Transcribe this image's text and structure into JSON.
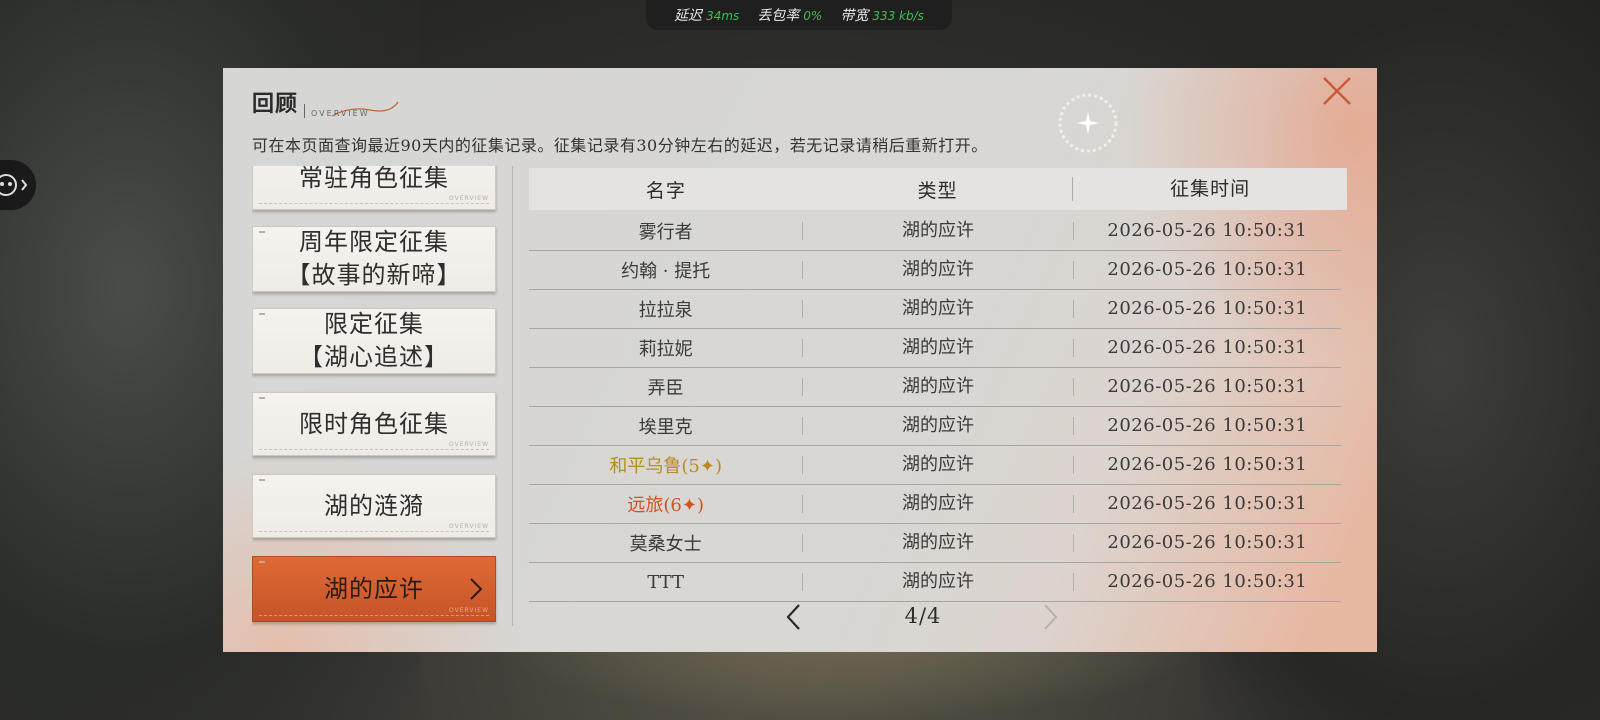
{
  "network": {
    "latency_label": "延迟",
    "latency_value": "34ms",
    "loss_label": "丢包率",
    "loss_value": "0%",
    "bandwidth_label": "带宽",
    "bandwidth_value": "333 kb/s"
  },
  "header": {
    "title": "回顾",
    "subtitle": "OVERVIEW",
    "notice": "可在本页面查询最近90天内的征集记录。征集记录有30分钟左右的延迟，若无记录请稍后重新打开。"
  },
  "categories": [
    {
      "label": "常驻角色征集",
      "foot": "OVERVIEW"
    },
    {
      "label": "周年限定征集\n【故事的新啼】",
      "foot": "OVERVIEW"
    },
    {
      "label": "限定征集\n【湖心追述】",
      "foot": "OVERVIEW"
    },
    {
      "label": "限时角色征集",
      "foot": "OVERVIEW"
    },
    {
      "label": "湖的涟漪",
      "foot": "OVERVIEW"
    },
    {
      "label": "湖的应许",
      "foot": "OVERVIEW",
      "active": true
    }
  ],
  "table": {
    "columns": [
      "名字",
      "类型",
      "征集时间"
    ],
    "rows": [
      {
        "name": "雾行者",
        "type": "湖的应许",
        "time": "2026-05-26 10:50:31"
      },
      {
        "name": "约翰 · 提托",
        "type": "湖的应许",
        "time": "2026-05-26 10:50:31"
      },
      {
        "name": "拉拉泉",
        "type": "湖的应许",
        "time": "2026-05-26 10:50:31"
      },
      {
        "name": "莉拉妮",
        "type": "湖的应许",
        "time": "2026-05-26 10:50:31"
      },
      {
        "name": "弄臣",
        "type": "湖的应许",
        "time": "2026-05-26 10:50:31"
      },
      {
        "name": "埃里克",
        "type": "湖的应许",
        "time": "2026-05-26 10:50:31"
      },
      {
        "name": "和平乌鲁(5",
        "star": "✦",
        "close": ")",
        "type": "湖的应许",
        "time": "2026-05-26 10:50:31",
        "rarity": "gold"
      },
      {
        "name": "远旅(6",
        "star": "✦",
        "close": ")",
        "type": "湖的应许",
        "time": "2026-05-26 10:50:31",
        "rarity": "orange"
      },
      {
        "name": "莫桑女士",
        "type": "湖的应许",
        "time": "2026-05-26 10:50:31"
      },
      {
        "name": "TTT",
        "type": "湖的应许",
        "time": "2026-05-26 10:50:31"
      }
    ]
  },
  "pagination": {
    "current": "4/4"
  },
  "colors": {
    "accent": "#d75e2e",
    "gold": "#b98a25",
    "orange": "#d0541c",
    "latency_green": "#3fbf55"
  },
  "icons": {
    "close": "close-icon",
    "prev": "chevron-left-icon",
    "next": "chevron-right-icon"
  }
}
